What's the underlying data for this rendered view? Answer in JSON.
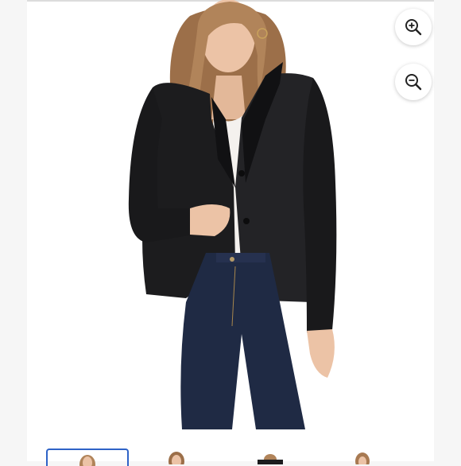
{
  "viewer": {
    "zoom_in_label": "Zoom in",
    "zoom_out_label": "Zoom out",
    "accent_color": "#2e63c7",
    "active_thumbnail": 0
  },
  "icons": {
    "zoom_in": "zoom-in-icon",
    "zoom_out": "zoom-out-icon"
  },
  "product_image": {
    "description_colors": {
      "blazer": "#1c1c1e",
      "top": "#f4f1ee",
      "jeans": "#1f2a44",
      "skin": "#e8bfa2",
      "hair": "#a87a52"
    }
  },
  "thumbnails": [
    {
      "index": 1
    },
    {
      "index": 2
    },
    {
      "index": 3
    },
    {
      "index": 4
    }
  ]
}
